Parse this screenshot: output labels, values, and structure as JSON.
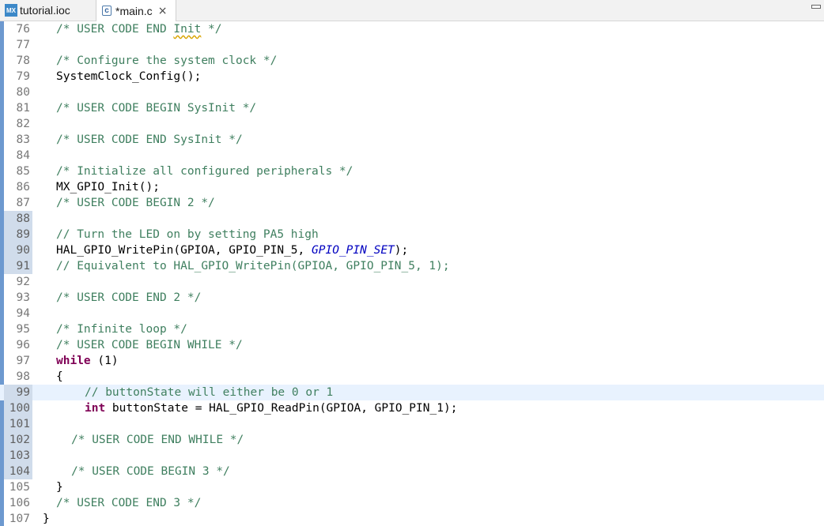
{
  "tabs": [
    {
      "label": "tutorial.ioc",
      "icon": "mx-icon",
      "icon_text": "MX",
      "active": false
    },
    {
      "label": "*main.c",
      "icon": "c-file-icon",
      "icon_text": "c",
      "active": true,
      "close": "×"
    }
  ],
  "editor": {
    "current_line": 99,
    "lines": [
      {
        "n": "76",
        "indent": 0,
        "tokens": [
          {
            "t": "cm",
            "v": "/* USER CODE END "
          },
          {
            "t": "cm-sq",
            "v": "Init"
          },
          {
            "t": "cm",
            "v": " */"
          }
        ]
      },
      {
        "n": "77",
        "indent": 0,
        "tokens": []
      },
      {
        "n": "78",
        "indent": 0,
        "tokens": [
          {
            "t": "cm",
            "v": "/* Configure the system clock */"
          }
        ]
      },
      {
        "n": "79",
        "indent": 0,
        "tokens": [
          {
            "t": "pl",
            "v": "SystemClock_Config();"
          }
        ]
      },
      {
        "n": "80",
        "indent": 0,
        "tokens": []
      },
      {
        "n": "81",
        "indent": 0,
        "tokens": [
          {
            "t": "cm",
            "v": "/* USER CODE BEGIN SysInit */"
          }
        ]
      },
      {
        "n": "82",
        "indent": 0,
        "tokens": []
      },
      {
        "n": "83",
        "indent": 0,
        "tokens": [
          {
            "t": "cm",
            "v": "/* USER CODE END SysInit */"
          }
        ]
      },
      {
        "n": "84",
        "indent": 0,
        "tokens": []
      },
      {
        "n": "85",
        "indent": 0,
        "tokens": [
          {
            "t": "cm",
            "v": "/* Initialize all configured peripherals */"
          }
        ]
      },
      {
        "n": "86",
        "indent": 0,
        "tokens": [
          {
            "t": "pl",
            "v": "MX_GPIO_Init();"
          }
        ]
      },
      {
        "n": "87",
        "indent": 0,
        "tokens": [
          {
            "t": "cm",
            "v": "/* USER CODE BEGIN 2 */"
          }
        ]
      },
      {
        "n": "88",
        "indent": 0,
        "marked": true,
        "tokens": []
      },
      {
        "n": "89",
        "indent": 0,
        "marked": true,
        "tokens": [
          {
            "t": "cm",
            "v": "// Turn the LED on by setting PA5 high"
          }
        ]
      },
      {
        "n": "90",
        "indent": 0,
        "marked": true,
        "tokens": [
          {
            "t": "pl",
            "v": "HAL_GPIO_WritePin(GPIOA, GPIO_PIN_5, "
          },
          {
            "t": "it",
            "v": "GPIO_PIN_SET"
          },
          {
            "t": "pl",
            "v": ");"
          }
        ]
      },
      {
        "n": "91",
        "indent": 0,
        "marked": true,
        "tokens": [
          {
            "t": "cm",
            "v": "// Equivalent to HAL_GPIO_WritePin(GPIOA, GPIO_PIN_5, 1);"
          }
        ]
      },
      {
        "n": "92",
        "indent": 0,
        "tokens": []
      },
      {
        "n": "93",
        "indent": 0,
        "tokens": [
          {
            "t": "cm",
            "v": "/* USER CODE END 2 */"
          }
        ]
      },
      {
        "n": "94",
        "indent": 0,
        "tokens": []
      },
      {
        "n": "95",
        "indent": 0,
        "tokens": [
          {
            "t": "cm",
            "v": "/* Infinite loop */"
          }
        ]
      },
      {
        "n": "96",
        "indent": 0,
        "tokens": [
          {
            "t": "cm",
            "v": "/* USER CODE BEGIN WHILE */"
          }
        ]
      },
      {
        "n": "97",
        "indent": 0,
        "tokens": [
          {
            "t": "kw",
            "v": "while"
          },
          {
            "t": "pl",
            "v": " (1)"
          }
        ]
      },
      {
        "n": "98",
        "indent": 0,
        "tokens": [
          {
            "t": "pl",
            "v": "{"
          }
        ]
      },
      {
        "n": "99",
        "indent": 1,
        "marked": true,
        "tokens": [
          {
            "t": "cm",
            "v": "// buttonState will either be 0 or 1"
          }
        ]
      },
      {
        "n": "100",
        "indent": 1,
        "marked": true,
        "tokens": [
          {
            "t": "kw",
            "v": "int"
          },
          {
            "t": "pl",
            "v": " buttonState = HAL_GPIO_ReadPin(GPIOA, GPIO_PIN_1);"
          }
        ]
      },
      {
        "n": "101",
        "indent": 0,
        "marked": true,
        "tokens": []
      },
      {
        "n": "102",
        "indent": 2,
        "marked": true,
        "tokens": [
          {
            "t": "cm",
            "v": "/* USER CODE END WHILE */"
          }
        ]
      },
      {
        "n": "103",
        "indent": 0,
        "marked": true,
        "tokens": []
      },
      {
        "n": "104",
        "indent": 2,
        "marked": true,
        "tokens": [
          {
            "t": "cm",
            "v": "/* USER CODE BEGIN 3 */"
          }
        ]
      },
      {
        "n": "105",
        "indent": 0,
        "tokens": [
          {
            "t": "pl",
            "v": "}"
          }
        ]
      },
      {
        "n": "106",
        "indent": 0,
        "tokens": [
          {
            "t": "cm",
            "v": "/* USER CODE END 3 */"
          }
        ]
      },
      {
        "n": "107",
        "indent": 3,
        "tokens": [
          {
            "t": "pl",
            "v": "}"
          }
        ]
      }
    ]
  }
}
